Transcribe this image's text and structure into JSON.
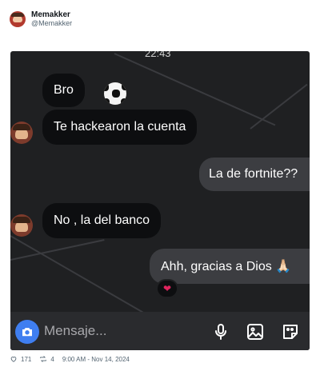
{
  "post": {
    "display_name": "Memakker",
    "handle": "@Memakker",
    "likes": "171",
    "reposts": "4",
    "timestamp": "9:00 AM - Nov 14, 2024"
  },
  "chat": {
    "clock": "22:43",
    "messages": [
      {
        "text": "Bro",
        "side": "incoming"
      },
      {
        "text": "Te hackearon la cuenta",
        "side": "incoming"
      },
      {
        "text": "La de fortnite??",
        "side": "outgoing"
      },
      {
        "text": "No , la del banco",
        "side": "incoming"
      },
      {
        "text": "Ahh, gracias a Dios 🙏🏻",
        "side": "outgoing"
      }
    ],
    "reaction": "❤",
    "composer_placeholder": "Mensaje..."
  },
  "colors": {
    "chat_background": "#1f2022",
    "incoming_bubble": "#0d0e10",
    "outgoing_bubble": "#3c3d41",
    "camera_button": "#3f7ef0",
    "reaction_heart": "#e0245e"
  },
  "icons": {
    "soccer_ball": "soccer-ball-icon",
    "camera": "camera-icon",
    "microphone": "microphone-icon",
    "gallery": "image-icon",
    "sticker": "sticker-icon",
    "like": "heart-outline-icon",
    "repost": "repost-icon"
  }
}
